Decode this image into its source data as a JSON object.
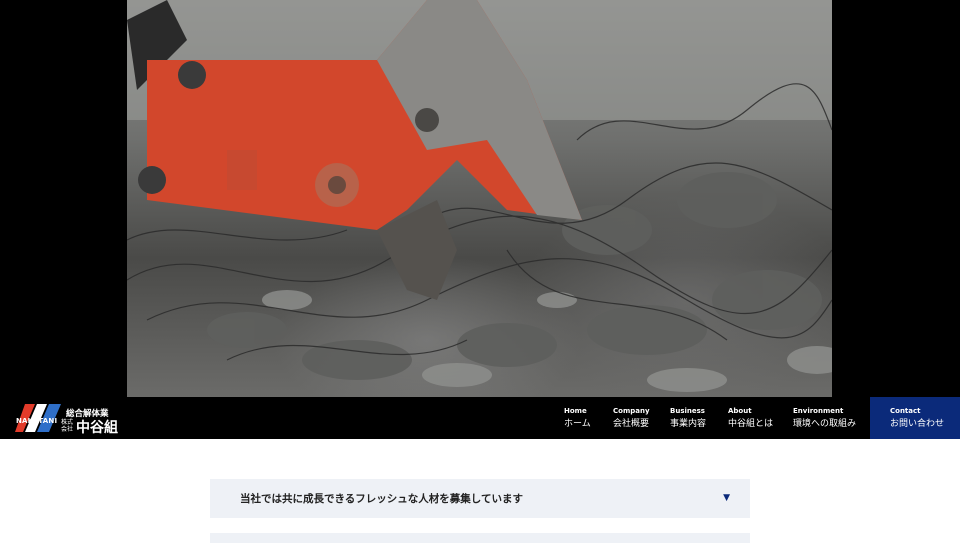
{
  "hero": {
    "image": "demolition-photo"
  },
  "logo": {
    "roman": "NAKATANI",
    "subtitle": "総合解体業",
    "kabushiki": "株式会社",
    "name": "中谷組"
  },
  "nav": [
    {
      "en": "Home",
      "ja": "ホーム"
    },
    {
      "en": "Company",
      "ja": "会社概要"
    },
    {
      "en": "Business",
      "ja": "事業内容"
    },
    {
      "en": "About",
      "ja": "中谷組とは"
    },
    {
      "en": "Environment",
      "ja": "環境への取組み"
    }
  ],
  "contact": {
    "en": "Contact",
    "ja": "お問い合わせ"
  },
  "accordion": {
    "title": "当社では共に成長できるフレッシュな人材を募集しています",
    "arrow_icon": "triangle-down-icon"
  },
  "colors": {
    "navbar": "#000000",
    "contact_bg": "#0b2a7a",
    "accordion_bg": "#eef1f6",
    "logo_red": "#e23b2a",
    "logo_blue": "#2f6fc9"
  }
}
